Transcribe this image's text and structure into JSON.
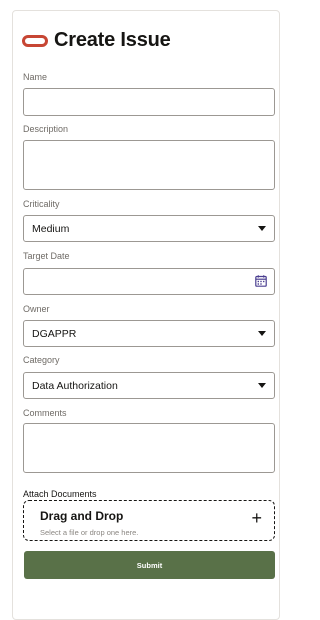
{
  "form": {
    "title": "Create Issue",
    "name": {
      "label": "Name",
      "value": ""
    },
    "description": {
      "label": "Description",
      "value": ""
    },
    "criticality": {
      "label": "Criticality",
      "value": "Medium"
    },
    "target_date": {
      "label": "Target Date",
      "value": ""
    },
    "owner": {
      "label": "Owner",
      "value": "DGAPPR"
    },
    "category": {
      "label": "Category",
      "value": "Data Authorization"
    },
    "comments": {
      "label": "Comments",
      "value": ""
    },
    "attach": {
      "label": "Attach Documents",
      "drop_title": "Drag and Drop",
      "drop_subtitle": "Select a file or drop one here.",
      "plus_icon": "plus-icon"
    },
    "submit_label": "Submit"
  },
  "colors": {
    "brand_red": "#c74634",
    "submit_green": "#597148",
    "border": "#9c9893",
    "label_gray": "#6f6b66"
  },
  "icons": {
    "calendar": "calendar-icon",
    "dropdown": "chevron-down-icon"
  }
}
